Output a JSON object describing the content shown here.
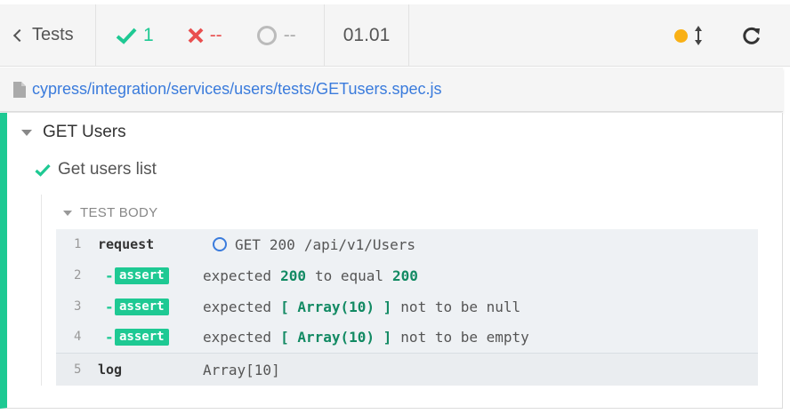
{
  "header": {
    "back_label": "Tests",
    "passed": "1",
    "failed": "--",
    "pending": "--",
    "duration": "01.01"
  },
  "file": {
    "path": "cypress/integration/services/users/tests/GETusers.spec.js"
  },
  "suite": {
    "title": "GET Users",
    "test": {
      "title": "Get users list",
      "body_label": "TEST BODY",
      "commands": [
        {
          "num": "1",
          "name": "request",
          "method": "GET",
          "status": "200",
          "url": "/api/v1/Users"
        },
        {
          "num": "2",
          "dash": "-",
          "badge": "assert",
          "w1": "expected",
          "v1": "200",
          "w2": "to equal",
          "v2": "200"
        },
        {
          "num": "3",
          "dash": "-",
          "badge": "assert",
          "w1": "expected",
          "v1": "[ Array(10) ]",
          "w2": "not to be null"
        },
        {
          "num": "4",
          "dash": "-",
          "badge": "assert",
          "w1": "expected",
          "v1": "[ Array(10) ]",
          "w2": "not to be empty"
        },
        {
          "num": "5",
          "name": "log",
          "msg": "Array[10]"
        }
      ]
    }
  },
  "colors": {
    "passed": "#1ec993",
    "failed": "#e94f4f",
    "link": "#3a7bdc",
    "running_dot": "#f9b015"
  },
  "icons": [
    "chevron-left-icon",
    "check-icon",
    "x-icon",
    "spinner-icon",
    "running-dot-icon",
    "scroll-updown-icon",
    "reload-icon",
    "file-icon",
    "caret-down-icon",
    "pending-circle-icon"
  ]
}
